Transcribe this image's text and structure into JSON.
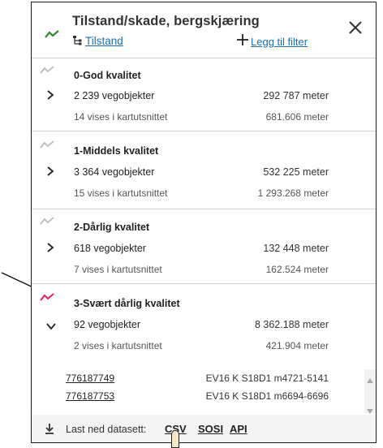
{
  "header": {
    "title": "Tilstand/skade, bergskjæring",
    "filter_link": "Tilstand",
    "add_filter": "Legg til filter",
    "trend_icon": "trend-line-icon",
    "close_icon": "close-icon",
    "accent": "#2e8b2e",
    "link_color": "#1b6fb0"
  },
  "groups": [
    {
      "title": "0-God kvalitet",
      "count": "2 239 vegobjekter",
      "length": "292 787 meter",
      "shown": "14 vises i kartutsnittet",
      "shown_length": "681.606 meter",
      "expanded": false,
      "color": "#bbbbbb"
    },
    {
      "title": "1-Middels kvalitet",
      "count": "3 364 vegobjekter",
      "length": "532 225 meter",
      "shown": "15 vises i kartutsnittet",
      "shown_length": "1 293.268 meter",
      "expanded": false,
      "color": "#bbbbbb"
    },
    {
      "title": "2-Dårlig kvalitet",
      "count": "618 vegobjekter",
      "length": "132 448 meter",
      "shown": "7 vises i kartutsnittet",
      "shown_length": "162.524 meter",
      "expanded": false,
      "color": "#bbbbbb"
    },
    {
      "title": "3-Svært dårlig kvalitet",
      "count": "92 vegobjekter",
      "length": "8 362.188 meter",
      "shown": "2 vises i kartutsnittet",
      "shown_length": "421.904 meter",
      "expanded": true,
      "color": "#e0245e"
    }
  ],
  "objects": [
    {
      "id": "776187749",
      "ref": "EV16 K S18D1 m4721-5141"
    },
    {
      "id": "776187753",
      "ref": "EV16 K S18D1 m6694-6696"
    }
  ],
  "footer": {
    "label": "Last ned datasett:",
    "links": [
      "CSV",
      "SOSI",
      "API"
    ]
  }
}
